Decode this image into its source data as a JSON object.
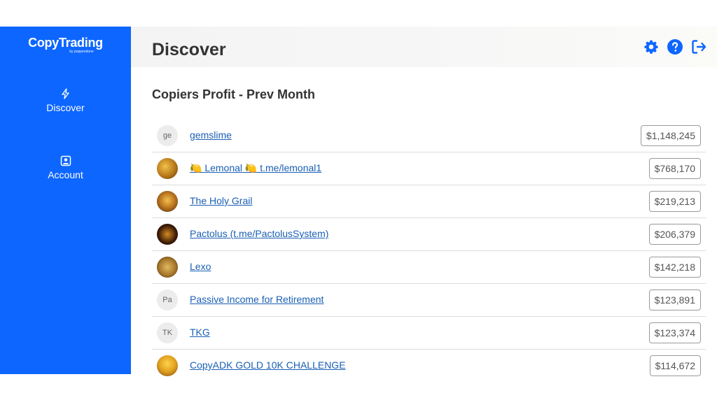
{
  "brand": {
    "name": "CopyTrading",
    "sub": "by pepperstone"
  },
  "sidebar": {
    "items": [
      {
        "label": "Discover",
        "icon": "lightning-icon"
      },
      {
        "label": "Account",
        "icon": "account-icon"
      }
    ]
  },
  "header": {
    "title": "Discover",
    "icons": [
      "gear-icon",
      "help-icon",
      "logout-icon"
    ],
    "accent": "#0d66ff"
  },
  "section": {
    "title": "Copiers Profit - Prev Month"
  },
  "traders": [
    {
      "initials": "ge",
      "name": "gemslime",
      "amount": "$1,148,245"
    },
    {
      "initials": "",
      "name": "🍋 Lemonal 🍋 t.me/lemonal1",
      "amount": "$768,170"
    },
    {
      "initials": "",
      "name": "The Holy Grail",
      "amount": "$219,213"
    },
    {
      "initials": "",
      "name": "Pactolus (t.me/PactolusSystem)",
      "amount": "$206,379"
    },
    {
      "initials": "",
      "name": "Lexo",
      "amount": "$142,218"
    },
    {
      "initials": "Pa",
      "name": "Passive Income for Retirement",
      "amount": "$123,891"
    },
    {
      "initials": "TK",
      "name": "TKG",
      "amount": "$123,374"
    },
    {
      "initials": "",
      "name": "CopyADK GOLD 10K CHALLENGE",
      "amount": "$114,672"
    }
  ]
}
